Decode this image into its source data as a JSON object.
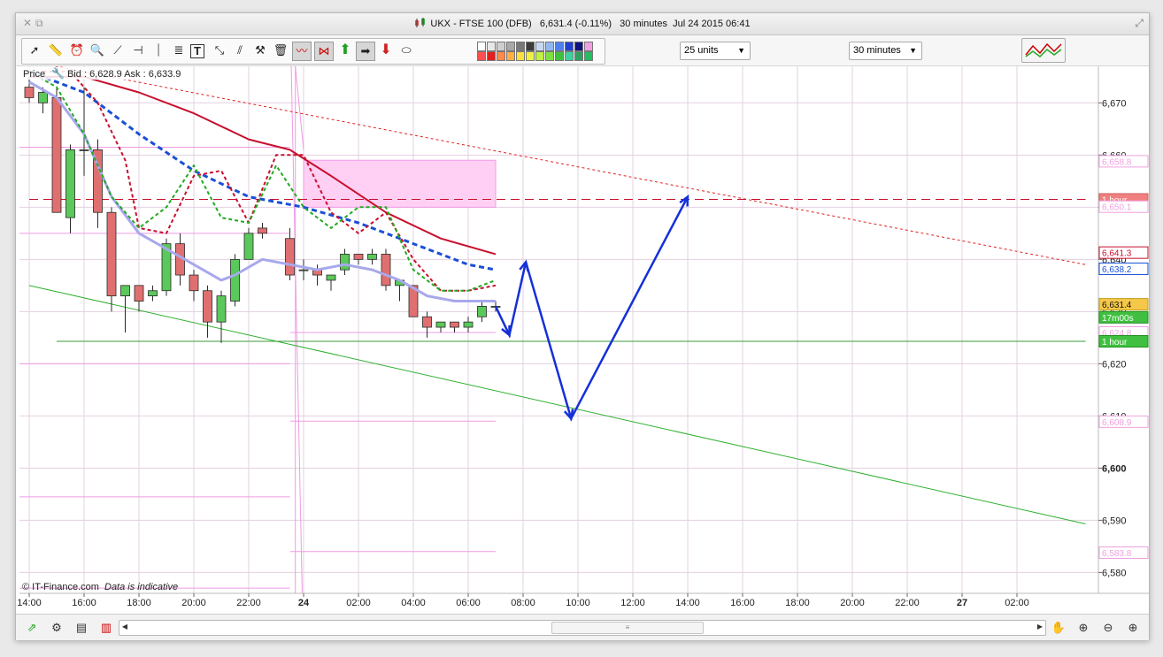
{
  "window": {
    "title": "UKX - FTSE 100 (DFB)",
    "price_change": "6,631.4 (-0.11%)",
    "interval": "30 minutes",
    "datetime": "Jul 24 2015 06:41"
  },
  "toolbar": {
    "units_select": "25 units",
    "interval_select": "30 minutes",
    "tool_icons": [
      "pointer-icon",
      "ruler-icon",
      "alarm-icon",
      "zoom-icon",
      "trendline-icon",
      "horizontal-line-icon",
      "vertical-line-icon",
      "fibonacci-icon",
      "text-icon",
      "arrow-line-icon",
      "channel-icon",
      "tools-icon",
      "trash-icon",
      "indicator-icon",
      "pattern-icon",
      "up-arrow-icon",
      "right-arrow-icon",
      "down-arrow-icon",
      "shape-icon"
    ],
    "palette_row1": [
      "#ffffff",
      "#e8e8e8",
      "#cfcfcf",
      "#a8a8a8",
      "#787878",
      "#3c3c3c",
      "#c8d8f0",
      "#90b8f0",
      "#5080f0",
      "#2040d0",
      "#101080",
      "#f0a0e0"
    ],
    "palette_row2": [
      "#ff5050",
      "#e02020",
      "#ff8a4a",
      "#ffb040",
      "#ffe040",
      "#f0f040",
      "#c0f040",
      "#80e040",
      "#40c040",
      "#40d0a0",
      "#30a060",
      "#20c060"
    ]
  },
  "bottom_icons": [
    "compare-icon",
    "indicators-icon",
    "notes-icon",
    "studies-icon",
    "chevron-left-icon",
    "chevron-right-icon",
    "drag-icon",
    "zoom-fit-icon",
    "zoom-out-icon",
    "zoom-in-icon"
  ],
  "header": {
    "price_label": "Price",
    "bid_ask": "Bid : 6,628.9 Ask : 6,633.9"
  },
  "footer": {
    "copyright": "© IT-Finance.com",
    "disclaimer": "Data is indicative"
  },
  "chart_data": {
    "type": "candlestick",
    "y_ticks": [
      {
        "v": 6670,
        "label": "6,670",
        "bold": false
      },
      {
        "v": 6660,
        "label": "6,660",
        "bold": false
      },
      {
        "v": 6650,
        "label": "6,650",
        "bold": false
      },
      {
        "v": 6640,
        "label": "6,640",
        "bold": false
      },
      {
        "v": 6630,
        "label": "6,630",
        "bold": false
      },
      {
        "v": 6620,
        "label": "6,620",
        "bold": false
      },
      {
        "v": 6610,
        "label": "6,610",
        "bold": false
      },
      {
        "v": 6600,
        "label": "6,600",
        "bold": true
      },
      {
        "v": 6590,
        "label": "6,590",
        "bold": false
      },
      {
        "v": 6580,
        "label": "6,580",
        "bold": false
      }
    ],
    "ylim": [
      6576,
      6677
    ],
    "x_ticks": [
      {
        "t": 0,
        "label": "14:00",
        "bold": false
      },
      {
        "t": 4,
        "label": "16:00",
        "bold": false
      },
      {
        "t": 8,
        "label": "18:00",
        "bold": false
      },
      {
        "t": 12,
        "label": "20:00",
        "bold": false
      },
      {
        "t": 16,
        "label": "22:00",
        "bold": false
      },
      {
        "t": 20,
        "label": "24",
        "bold": true
      },
      {
        "t": 24,
        "label": "02:00",
        "bold": false
      },
      {
        "t": 28,
        "label": "04:00",
        "bold": false
      },
      {
        "t": 32,
        "label": "06:00",
        "bold": false
      },
      {
        "t": 36,
        "label": "08:00",
        "bold": false
      },
      {
        "t": 40,
        "label": "10:00",
        "bold": false
      },
      {
        "t": 44,
        "label": "12:00",
        "bold": false
      },
      {
        "t": 48,
        "label": "14:00",
        "bold": false
      },
      {
        "t": 52,
        "label": "16:00",
        "bold": false
      },
      {
        "t": 56,
        "label": "18:00",
        "bold": false
      },
      {
        "t": 60,
        "label": "20:00",
        "bold": false
      },
      {
        "t": 64,
        "label": "22:00",
        "bold": false
      },
      {
        "t": 68,
        "label": "27",
        "bold": true
      },
      {
        "t": 72,
        "label": "02:00",
        "bold": false
      }
    ],
    "candles": [
      {
        "t": 0,
        "o": 6673,
        "h": 6675,
        "l": 6670,
        "c": 6671
      },
      {
        "t": 1,
        "o": 6670,
        "h": 6673,
        "l": 6668,
        "c": 6672
      },
      {
        "t": 2,
        "o": 6671,
        "h": 6673,
        "l": 6654,
        "c": 6649
      },
      {
        "t": 3,
        "o": 6648,
        "h": 6662,
        "l": 6645,
        "c": 6661
      },
      {
        "t": 4,
        "o": 6661,
        "h": 6673,
        "l": 6656,
        "c": 6661
      },
      {
        "t": 5,
        "o": 6661,
        "h": 6663,
        "l": 6646,
        "c": 6649
      },
      {
        "t": 6,
        "o": 6649,
        "h": 6650,
        "l": 6630,
        "c": 6633
      },
      {
        "t": 7,
        "o": 6633,
        "h": 6635,
        "l": 6626,
        "c": 6635
      },
      {
        "t": 8,
        "o": 6635,
        "h": 6635,
        "l": 6630,
        "c": 6632
      },
      {
        "t": 9,
        "o": 6633,
        "h": 6635,
        "l": 6632,
        "c": 6634
      },
      {
        "t": 10,
        "o": 6634,
        "h": 6644,
        "l": 6633,
        "c": 6643
      },
      {
        "t": 11,
        "o": 6643,
        "h": 6645,
        "l": 6635,
        "c": 6637
      },
      {
        "t": 12,
        "o": 6637,
        "h": 6638,
        "l": 6632,
        "c": 6634
      },
      {
        "t": 13,
        "o": 6634,
        "h": 6635,
        "l": 6625,
        "c": 6628
      },
      {
        "t": 14,
        "o": 6628,
        "h": 6634,
        "l": 6624,
        "c": 6633
      },
      {
        "t": 15,
        "o": 6632,
        "h": 6641,
        "l": 6631,
        "c": 6640
      },
      {
        "t": 16,
        "o": 6640,
        "h": 6646,
        "l": 6640,
        "c": 6645
      },
      {
        "t": 17,
        "o": 6646,
        "h": 6647,
        "l": 6644,
        "c": 6645
      },
      {
        "t": 19,
        "o": 6644,
        "h": 6646,
        "l": 6636,
        "c": 6637
      },
      {
        "t": 20,
        "o": 6638,
        "h": 6640,
        "l": 6636,
        "c": 6638
      },
      {
        "t": 21,
        "o": 6638,
        "h": 6639,
        "l": 6635,
        "c": 6637
      },
      {
        "t": 22,
        "o": 6636,
        "h": 6637,
        "l": 6634,
        "c": 6637
      },
      {
        "t": 23,
        "o": 6638,
        "h": 6642,
        "l": 6637,
        "c": 6641
      },
      {
        "t": 24,
        "o": 6641,
        "h": 6641,
        "l": 6639,
        "c": 6640
      },
      {
        "t": 25,
        "o": 6640,
        "h": 6642,
        "l": 6639,
        "c": 6641
      },
      {
        "t": 26,
        "o": 6641,
        "h": 6642,
        "l": 6634,
        "c": 6635
      },
      {
        "t": 27,
        "o": 6635,
        "h": 6636,
        "l": 6632,
        "c": 6636
      },
      {
        "t": 28,
        "o": 6635,
        "h": 6635,
        "l": 6629,
        "c": 6629
      },
      {
        "t": 29,
        "o": 6629,
        "h": 6630,
        "l": 6625,
        "c": 6627
      },
      {
        "t": 30,
        "o": 6627,
        "h": 6628,
        "l": 6626,
        "c": 6628
      },
      {
        "t": 31,
        "o": 6628,
        "h": 6628,
        "l": 6626,
        "c": 6627
      },
      {
        "t": 32,
        "o": 6627,
        "h": 6629,
        "l": 6626,
        "c": 6628
      },
      {
        "t": 33,
        "o": 6629,
        "h": 6632,
        "l": 6628,
        "c": 6631
      },
      {
        "t": 34,
        "o": 6631,
        "h": 6632,
        "l": 6630,
        "c": 6631
      }
    ],
    "moving_averages": [
      {
        "color": "#c8102e",
        "dash": "solid",
        "width": 2,
        "points": [
          [
            0,
            6675
          ],
          [
            4,
            6675
          ],
          [
            8,
            6672
          ],
          [
            12,
            6668
          ],
          [
            16,
            6663
          ],
          [
            19,
            6661
          ],
          [
            22,
            6656
          ],
          [
            26,
            6649
          ],
          [
            30,
            6644
          ],
          [
            34,
            6641
          ]
        ]
      },
      {
        "color": "#1a4fd6",
        "dash": "6,4",
        "width": 3,
        "points": [
          [
            0,
            6676
          ],
          [
            2,
            6674
          ],
          [
            4,
            6672
          ],
          [
            8,
            6664
          ],
          [
            12,
            6657
          ],
          [
            16,
            6652
          ],
          [
            20,
            6650
          ],
          [
            24,
            6647
          ],
          [
            28,
            6643
          ],
          [
            32,
            6639
          ],
          [
            34,
            6638
          ]
        ]
      },
      {
        "color": "#a8a8ec",
        "dash": "solid",
        "width": 3,
        "points": [
          [
            0,
            6674
          ],
          [
            2,
            6671
          ],
          [
            4,
            6664
          ],
          [
            6,
            6652
          ],
          [
            8,
            6645
          ],
          [
            10,
            6642
          ],
          [
            12,
            6639
          ],
          [
            14,
            6636
          ],
          [
            15,
            6637
          ],
          [
            17,
            6640
          ],
          [
            19,
            6639
          ],
          [
            21,
            6638
          ],
          [
            23,
            6639
          ],
          [
            25,
            6638
          ],
          [
            27,
            6636
          ],
          [
            29,
            6633
          ],
          [
            31,
            6632
          ],
          [
            34,
            6632
          ]
        ]
      },
      {
        "color": "#c8102e",
        "dash": "4,3",
        "width": 2,
        "points": [
          [
            1,
            6676
          ],
          [
            3,
            6676
          ],
          [
            5,
            6670
          ],
          [
            7,
            6659
          ],
          [
            8,
            6646
          ],
          [
            10,
            6645
          ],
          [
            12,
            6656
          ],
          [
            14,
            6657
          ],
          [
            16,
            6647
          ],
          [
            18,
            6660
          ],
          [
            20,
            6660
          ],
          [
            22,
            6649
          ],
          [
            24,
            6645
          ],
          [
            26,
            6649
          ],
          [
            28,
            6640
          ],
          [
            30,
            6634
          ],
          [
            32,
            6634
          ],
          [
            34,
            6635
          ]
        ]
      },
      {
        "color": "#22aa22",
        "dash": "4,3",
        "width": 2,
        "points": [
          [
            0,
            6676
          ],
          [
            2,
            6673
          ],
          [
            4,
            6664
          ],
          [
            6,
            6652
          ],
          [
            8,
            6646
          ],
          [
            10,
            6650
          ],
          [
            12,
            6658
          ],
          [
            14,
            6648
          ],
          [
            16,
            6647
          ],
          [
            18,
            6658
          ],
          [
            20,
            6650
          ],
          [
            22,
            6646
          ],
          [
            24,
            6650
          ],
          [
            26,
            6650
          ],
          [
            28,
            6638
          ],
          [
            30,
            6634
          ],
          [
            32,
            6634
          ],
          [
            34,
            6636
          ]
        ]
      }
    ],
    "horizontal_lines": [
      {
        "price": 6651.5,
        "t_from": 0,
        "t_to": 77,
        "color": "#c8102e",
        "dash": "10,6",
        "badge": "1 hour",
        "badge_bg": "#f08080",
        "badge_fg": "#ffffff"
      },
      {
        "price": 6624.3,
        "t_from": 2,
        "t_to": 77,
        "color": "#3a9a3a",
        "dash": "solid",
        "badge": "1 hour",
        "badge_bg": "#30c030",
        "badge_fg": "#ffffff"
      }
    ],
    "trendlines": [
      {
        "color": "#e02020",
        "dash": "3,3",
        "width": 1,
        "from": [
          0,
          6678
        ],
        "to": [
          77,
          6639
        ]
      },
      {
        "color": "#30b030",
        "dash": "solid",
        "width": 1,
        "from": [
          0,
          6635
        ],
        "to": [
          77,
          6589.3
        ]
      }
    ],
    "pivot_boxes": [
      {
        "t_from": 20,
        "t_to": 34,
        "low": 6650,
        "high": 6659,
        "fill": "#ffd0f4",
        "stroke": "#ef9be4"
      }
    ],
    "pivot_lines": [
      {
        "t_from": 0,
        "t_to": 19,
        "price": 6661.5
      },
      {
        "t_from": 0,
        "t_to": 19,
        "price": 6645
      },
      {
        "t_from": 0,
        "t_to": 19,
        "price": 6620
      },
      {
        "t_from": 0,
        "t_to": 19,
        "price": 6594.5
      },
      {
        "t_from": 0,
        "t_to": 19,
        "price": 6577
      },
      {
        "t_from": 20,
        "t_to": 34,
        "price": 6626
      },
      {
        "t_from": 20,
        "t_to": 34,
        "price": 6609
      },
      {
        "t_from": 20,
        "t_to": 34,
        "price": 6584
      }
    ],
    "drawn_arrow": {
      "color": "#1530d8",
      "points": [
        [
          34,
          6631
        ],
        [
          35,
          6625.5
        ],
        [
          36.2,
          6639.5
        ],
        [
          39.5,
          6609.5
        ],
        [
          48,
          6652
        ]
      ]
    },
    "right_labels": [
      {
        "price": 6658.8,
        "text": "6,658.8",
        "bg": "#ffffff",
        "fg": "#f0a0e0",
        "border": "#f0a0e0"
      },
      {
        "price": 6651.5,
        "text": "1 hour",
        "bg": "#f08080",
        "fg": "#ffffff",
        "border": "#d06060"
      },
      {
        "price": 6650.1,
        "text": "6,650.1",
        "bg": "#ffffff",
        "fg": "#f0a0e0",
        "border": "#f0a0e0"
      },
      {
        "price": 6641.3,
        "text": "6,641.3",
        "bg": "#ffffff",
        "fg": "#c8102e",
        "border": "#c8102e"
      },
      {
        "price": 6638.2,
        "text": "6,638.2",
        "bg": "#ffffff",
        "fg": "#1a4fd6",
        "border": "#1a4fd6"
      },
      {
        "price": 6631.4,
        "text": "6,631.4",
        "bg": "#f6c84a",
        "fg": "#111111",
        "border": "#c0a020"
      },
      {
        "price": 6628.9,
        "text": "17m00s",
        "bg": "#40c040",
        "fg": "#ffffff",
        "border": "#209020"
      },
      {
        "price": 6626.0,
        "text": "6,624.8",
        "bg": "#ffffff",
        "fg": "#f0a0e0",
        "border": "#f0a0e0"
      },
      {
        "price": 6624.3,
        "text": "1 hour",
        "bg": "#40c040",
        "fg": "#ffffff",
        "border": "#209020"
      },
      {
        "price": 6608.9,
        "text": "6,608.9",
        "bg": "#ffffff",
        "fg": "#f0a0e0",
        "border": "#f0a0e0"
      },
      {
        "price": 6583.8,
        "text": "6,583.8",
        "bg": "#ffffff",
        "fg": "#f0a0e0",
        "border": "#f0a0e0"
      }
    ],
    "colors": {
      "up": "#5ac85a",
      "down": "#e07070",
      "candle_border": "#2a2a2a",
      "grid": "#e3d0e0"
    }
  }
}
